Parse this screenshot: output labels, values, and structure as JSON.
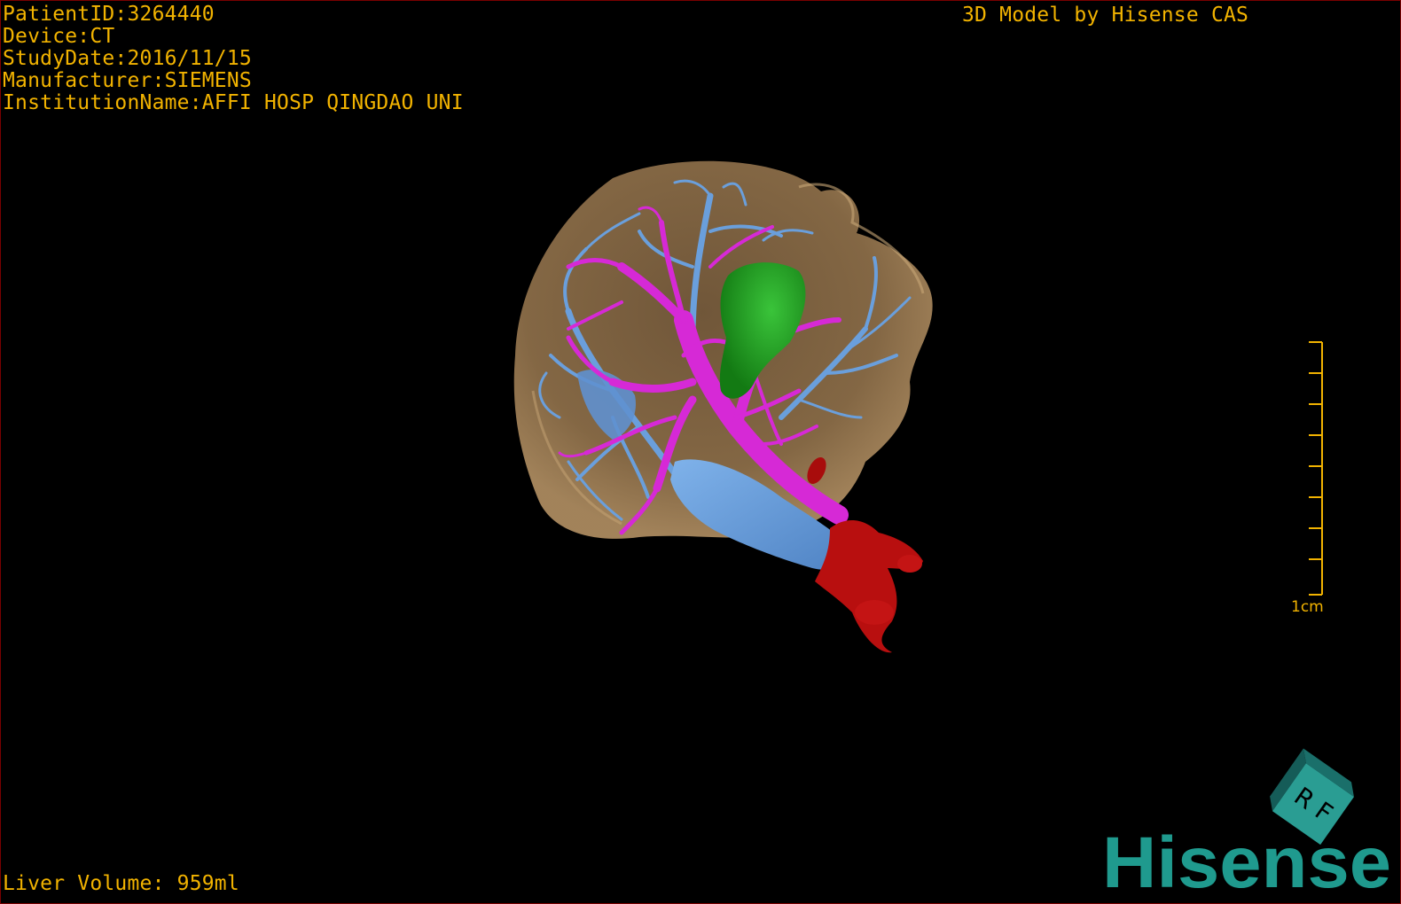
{
  "header": {
    "patient_id": "PatientID:3264440",
    "device": "Device:CT",
    "study_date": "StudyDate:2016/11/15",
    "manufacturer": "Manufacturer:SIEMENS",
    "institution": "InstitutionName:AFFI HOSP QINGDAO UNI"
  },
  "credit": "3D Model by Hisense CAS",
  "footer": {
    "liver_volume": "Liver Volume: 959ml"
  },
  "scale": {
    "label": "1cm"
  },
  "orientation": {
    "labels": [
      "R",
      "F"
    ]
  },
  "brand": {
    "name": "Hisense"
  },
  "colors": {
    "overlay_text": "#f2b300",
    "liver": "#9b7a52",
    "hepatic_vein": "#6a9fdc",
    "portal_vein": "#d629d6",
    "gallbladder": "#1f9e1f",
    "artery": "#b80f0f",
    "brand": "#1f9a8e"
  },
  "icons": [
    "orientation-cube-icon",
    "hisense-logo"
  ]
}
